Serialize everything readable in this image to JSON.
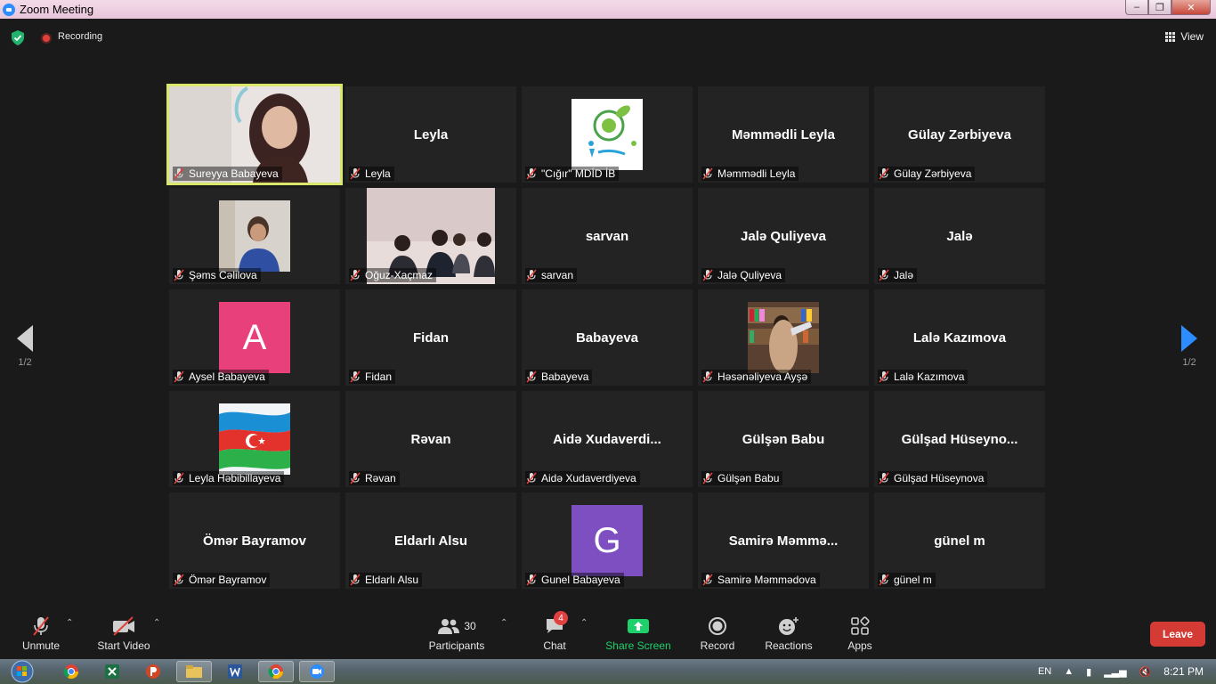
{
  "window": {
    "title": "Zoom Meeting",
    "min": "–",
    "max": "❐",
    "close": "✕"
  },
  "topbar": {
    "recording": "Recording",
    "view": "View"
  },
  "pager": {
    "left": "1/2",
    "right": "1/2"
  },
  "tiles": [
    {
      "name": "Sureyya Babayeva",
      "center": "",
      "kind": "video",
      "active": true
    },
    {
      "name": "Leyla",
      "center": "Leyla",
      "kind": "name"
    },
    {
      "name": "\"Cığır\" MDİD İB",
      "center": "",
      "kind": "logo-cigir"
    },
    {
      "name": "Məmmədli Leyla",
      "center": "Məmmədli Leyla",
      "kind": "name"
    },
    {
      "name": "Gülay Zərbiyeva",
      "center": "Gülay Zərbiyeva",
      "kind": "name"
    },
    {
      "name": "Şəms Cəlilova",
      "center": "",
      "kind": "photo-kid"
    },
    {
      "name": "Oğuz-Xaçmaz",
      "center": "",
      "kind": "photo-group"
    },
    {
      "name": "sarvan",
      "center": "sarvan",
      "kind": "name"
    },
    {
      "name": "Jalə Quliyeva",
      "center": "Jalə Quliyeva",
      "kind": "name"
    },
    {
      "name": "Jalə",
      "center": "Jalə",
      "kind": "name"
    },
    {
      "name": "Aysel Babayeva",
      "center": "",
      "kind": "letter",
      "letter": "A",
      "color": "#e8407a"
    },
    {
      "name": "Fidan",
      "center": "Fidan",
      "kind": "name"
    },
    {
      "name": "Babayeva",
      "center": "Babayeva",
      "kind": "name"
    },
    {
      "name": "Həsənəliyeva Ayşə",
      "center": "",
      "kind": "photo-books"
    },
    {
      "name": "Lalə Kazımova",
      "center": "Lalə Kazımova",
      "kind": "name"
    },
    {
      "name": "Leyla Həbibillayeva",
      "center": "",
      "kind": "flag"
    },
    {
      "name": "Rəvan",
      "center": "Rəvan",
      "kind": "name"
    },
    {
      "name": "Aidə Xudaverdiyeva",
      "center": "Aidə Xudaverdi...",
      "kind": "name"
    },
    {
      "name": "Gülşən Babu",
      "center": "Gülşən Babu",
      "kind": "name"
    },
    {
      "name": "Gülşad Hüseynova",
      "center": "Gülşad  Hüseyno...",
      "kind": "name"
    },
    {
      "name": "Ömər Bayramov",
      "center": "Ömər Bayramov",
      "kind": "name"
    },
    {
      "name": "Eldarlı Alsu",
      "center": "Eldarlı Alsu",
      "kind": "name"
    },
    {
      "name": "Gunel Babayeva",
      "center": "",
      "kind": "letter",
      "letter": "G",
      "color": "#7e4fc1"
    },
    {
      "name": "Samirə Məmmədova",
      "center": "Samirə  Məmmə...",
      "kind": "name"
    },
    {
      "name": "günel m",
      "center": "günel m",
      "kind": "name"
    }
  ],
  "toolbar": {
    "unmute": "Unmute",
    "start_video": "Start Video",
    "participants": "Participants",
    "participants_count": "30",
    "chat": "Chat",
    "chat_badge": "4",
    "share": "Share Screen",
    "record": "Record",
    "reactions": "Reactions",
    "apps": "Apps",
    "leave": "Leave"
  },
  "taskbar": {
    "lang": "EN",
    "time": "8:21 PM"
  },
  "colors": {
    "accent": "#2d8cff",
    "share": "#1fd16b",
    "leave": "#d33b34",
    "active_border": "#d9e86a"
  }
}
